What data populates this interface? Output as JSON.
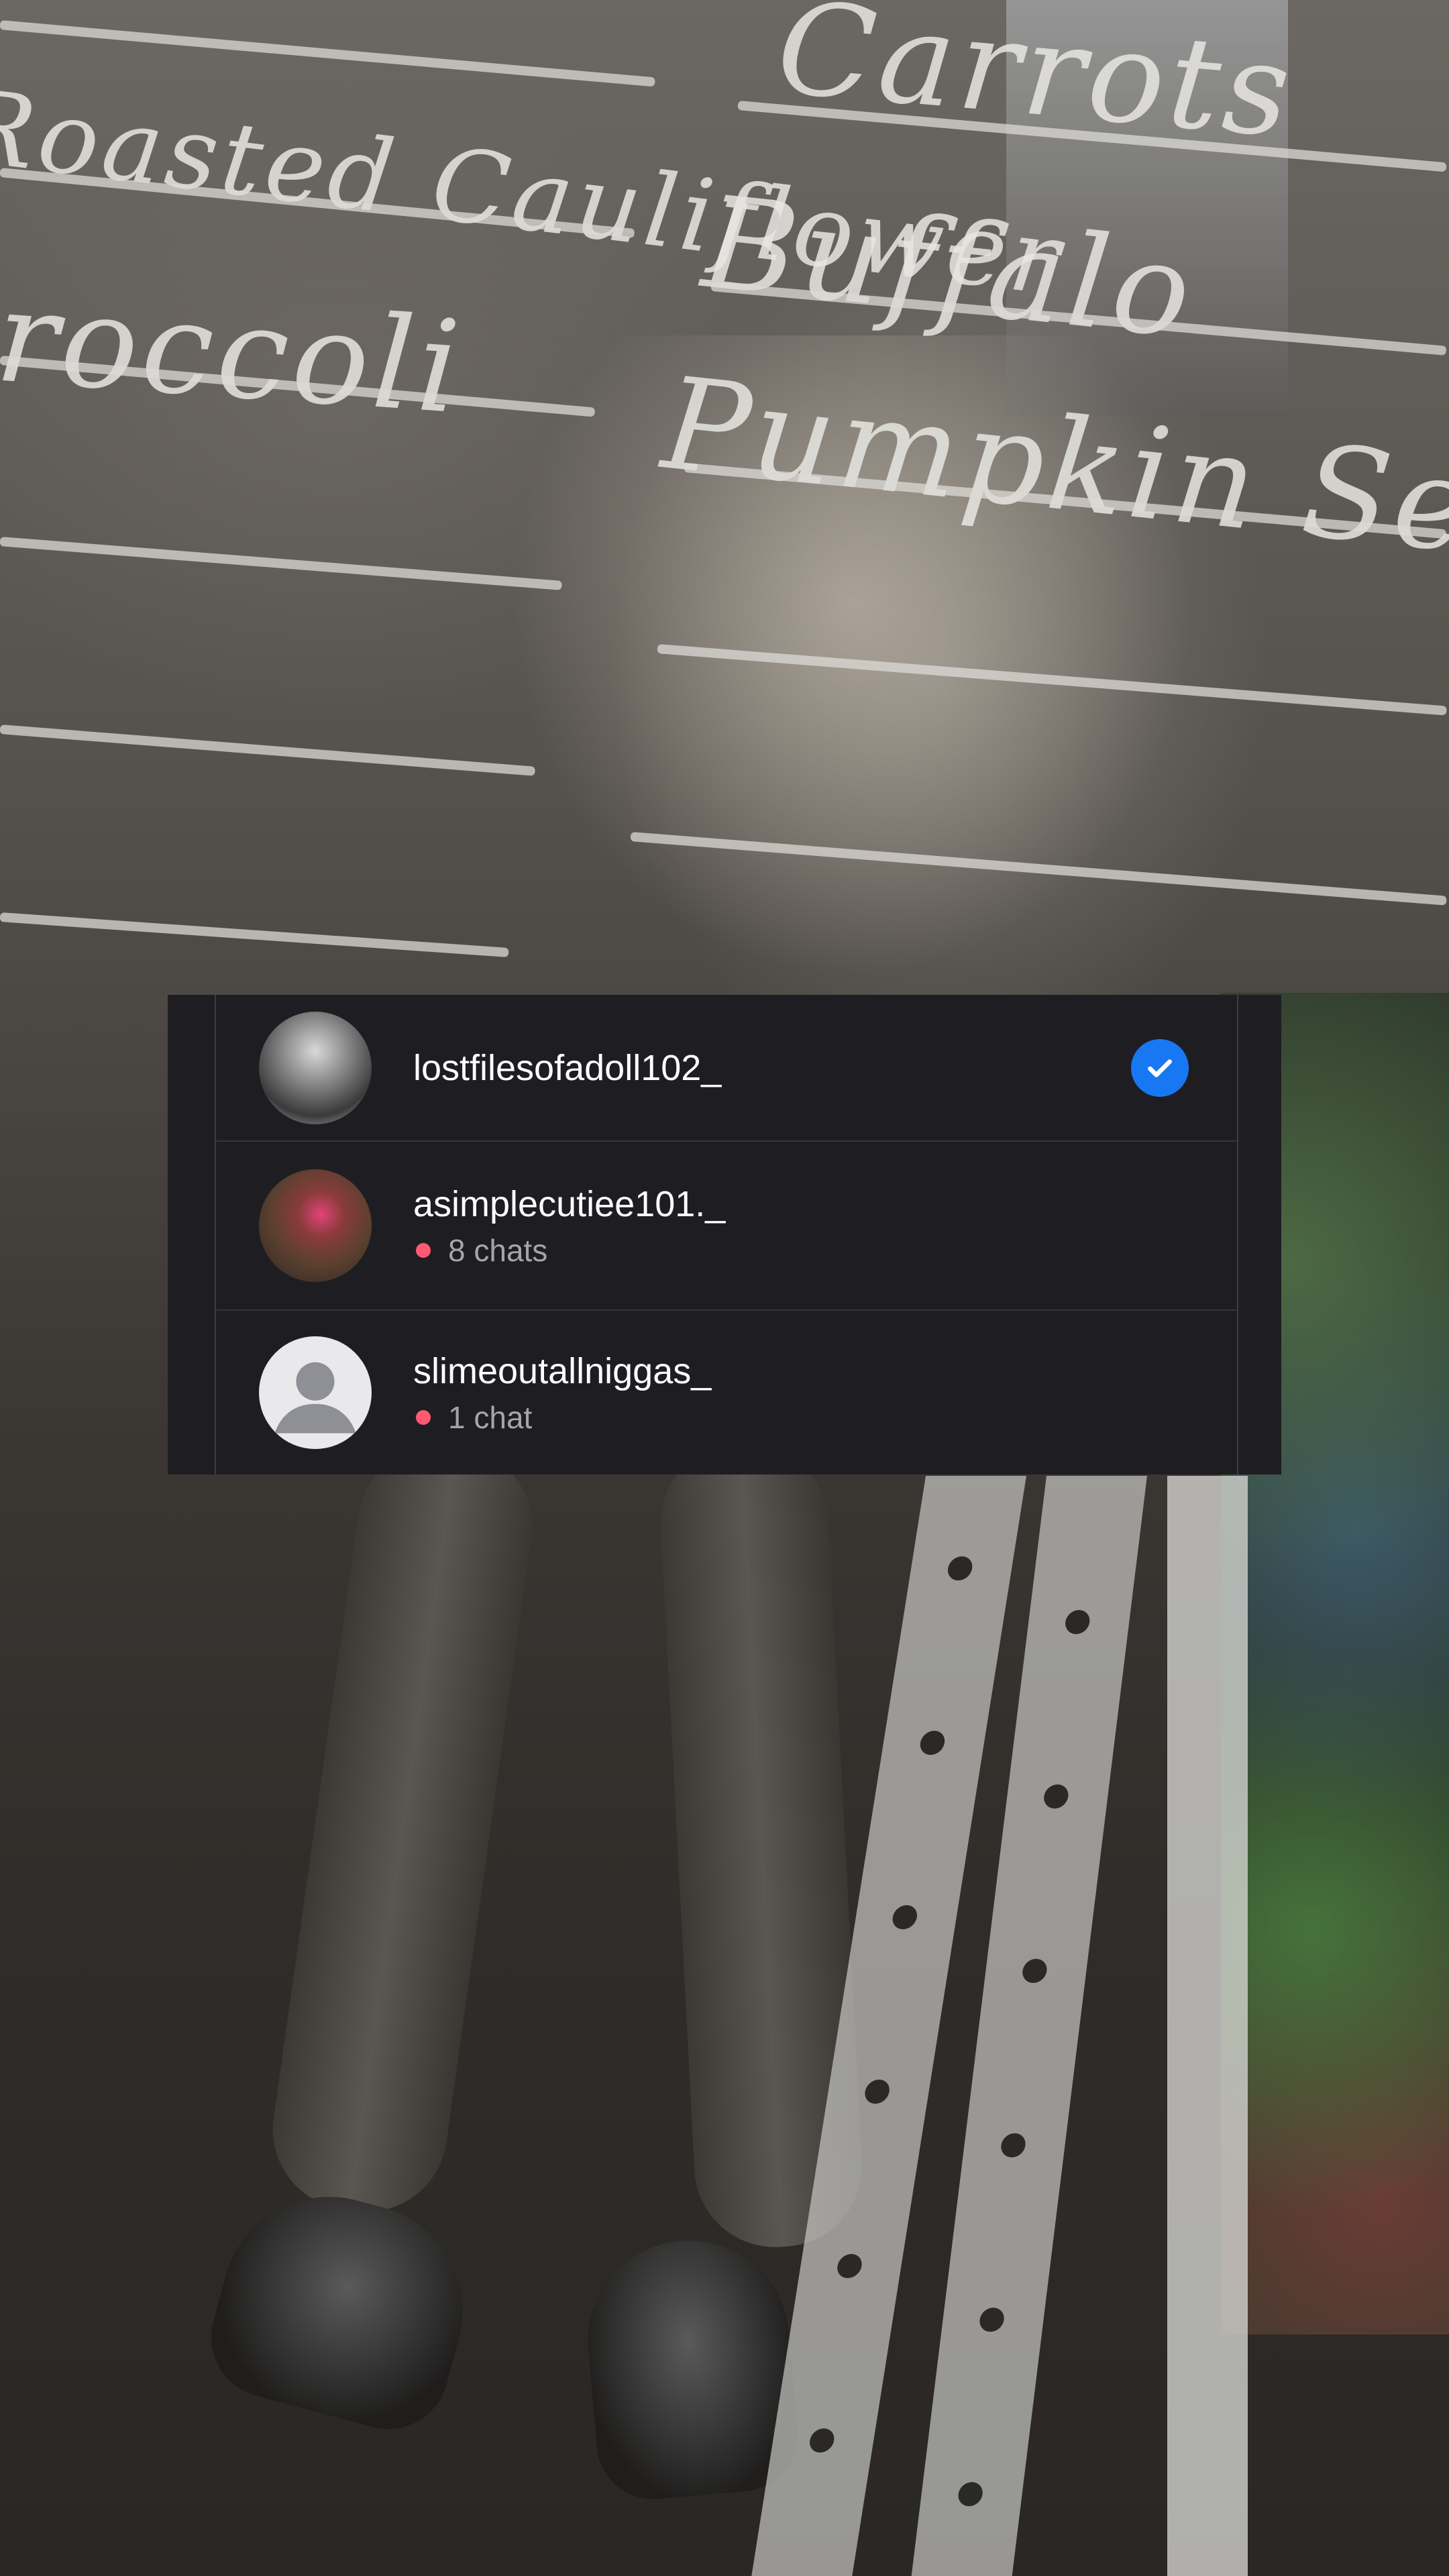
{
  "background": {
    "glass_words": [
      "Carrots",
      "Roasted Cauliflower",
      "Buffalo",
      "Broccoli",
      "Pumpkin Seeds"
    ]
  },
  "accounts": [
    {
      "username": "lostfilesofadoll102_",
      "avatar_icon": "profile-photo",
      "selected": true,
      "selected_icon": "checkmark-circle-icon"
    },
    {
      "username": "asimplecutiee101._",
      "avatar_icon": "profile-photo",
      "chats": "8 chats",
      "badge_color": "#ff5a72"
    },
    {
      "username": "slimeoutallniggas_",
      "avatar_icon": "default-avatar-icon",
      "chats": "1 chat",
      "badge_color": "#ff5a72"
    }
  ],
  "colors": {
    "panel_background": "#1e1e22",
    "accent_blue": "#1877f2",
    "unread_dot": "#ff5a72"
  }
}
